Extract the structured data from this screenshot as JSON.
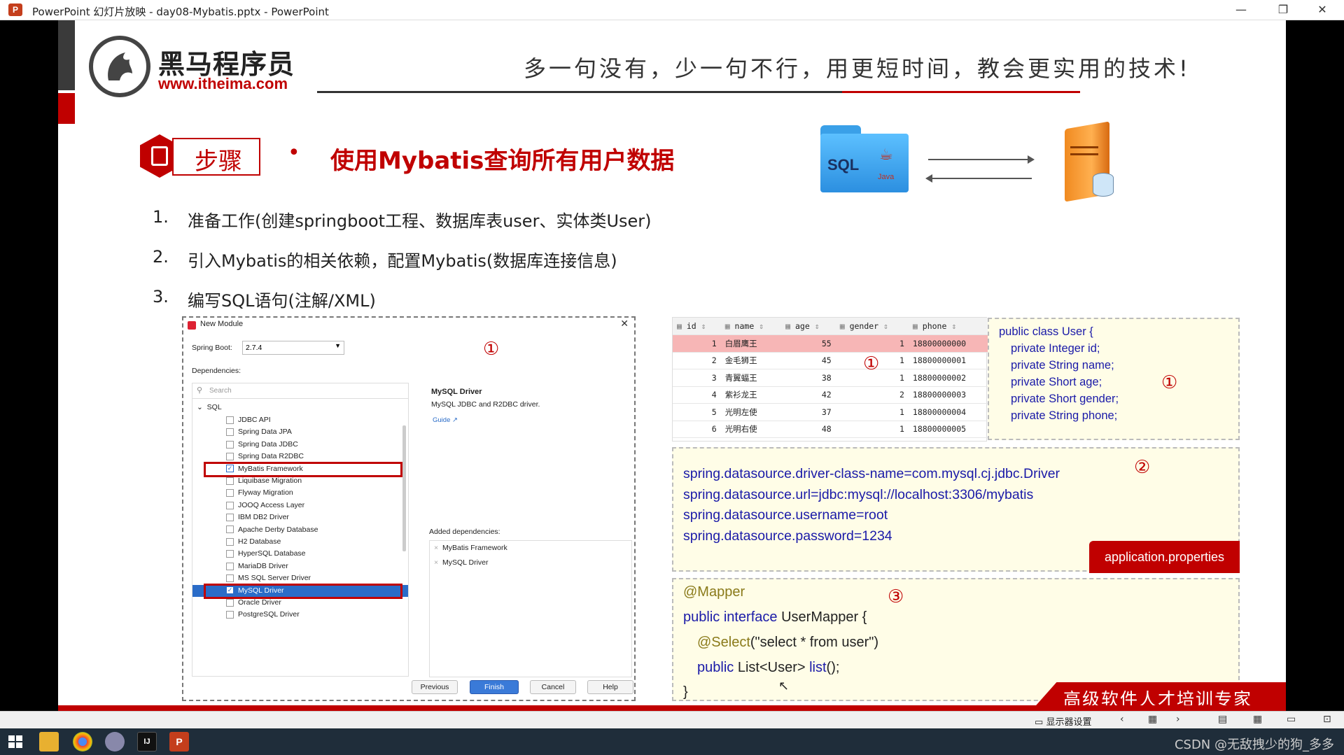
{
  "window": {
    "title": "PowerPoint 幻灯片放映  -  day08-Mybatis.pptx - PowerPoint",
    "app_icon": "P",
    "controls": {
      "minimize": "—",
      "restore": "❐",
      "close": "✕"
    }
  },
  "slide": {
    "logo": {
      "name": "黑马程序员",
      "url": "www.itheima.com"
    },
    "slogan": "多一句没有，少一句不行，用更短时间，教会更实用的技术!",
    "step_label": "步骤",
    "bullet": "•",
    "heading": "使用Mybatis查询所有用户数据",
    "diagram": {
      "sql_label": "SQL",
      "java_label": "Java"
    },
    "steps": [
      {
        "num": "1.",
        "text": "准备工作(创建springboot工程、数据库表user、实体类User)"
      },
      {
        "num": "2.",
        "text": "引入Mybatis的相关依赖，配置Mybatis(数据库连接信息)"
      },
      {
        "num": "3.",
        "text": "编写SQL语句(注解/XML)"
      }
    ],
    "dialog": {
      "title": "New Module",
      "close": "✕",
      "spring_boot_label": "Spring Boot:",
      "spring_boot_value": "2.7.4",
      "dependencies_label": "Dependencies:",
      "search_placeholder": "Search",
      "group": "SQL",
      "deps": [
        {
          "label": "JDBC API",
          "checked": false
        },
        {
          "label": "Spring Data JPA",
          "checked": false
        },
        {
          "label": "Spring Data JDBC",
          "checked": false
        },
        {
          "label": "Spring Data R2DBC",
          "checked": false
        },
        {
          "label": "MyBatis Framework",
          "checked": true
        },
        {
          "label": "Liquibase Migration",
          "checked": false
        },
        {
          "label": "Flyway Migration",
          "checked": false
        },
        {
          "label": "JOOQ Access Layer",
          "checked": false
        },
        {
          "label": "IBM DB2 Driver",
          "checked": false
        },
        {
          "label": "Apache Derby Database",
          "checked": false
        },
        {
          "label": "H2 Database",
          "checked": false
        },
        {
          "label": "HyperSQL Database",
          "checked": false
        },
        {
          "label": "MariaDB Driver",
          "checked": false
        },
        {
          "label": "MS SQL Server Driver",
          "checked": false
        },
        {
          "label": "MySQL Driver",
          "checked": true
        },
        {
          "label": "Oracle Driver",
          "checked": false
        },
        {
          "label": "PostgreSQL Driver",
          "checked": false
        }
      ],
      "detail_title": "MySQL Driver",
      "detail_desc": "MySQL JDBC and R2DBC driver.",
      "detail_link": "Guide ↗",
      "added_label": "Added dependencies:",
      "added": [
        "MyBatis Framework",
        "MySQL Driver"
      ],
      "buttons": {
        "previous": "Previous",
        "finish": "Finish",
        "cancel": "Cancel",
        "help": "Help"
      },
      "marker": "①"
    },
    "table": {
      "columns": [
        "id",
        "name",
        "age",
        "gender",
        "phone"
      ],
      "rows": [
        [
          "1",
          "白眉鹰王",
          "55",
          "1",
          "18800000000"
        ],
        [
          "2",
          "金毛狮王",
          "45",
          "1",
          "18800000001"
        ],
        [
          "3",
          "青翼蝠王",
          "38",
          "1",
          "18800000002"
        ],
        [
          "4",
          "紫衫龙王",
          "42",
          "2",
          "18800000003"
        ],
        [
          "5",
          "光明左使",
          "37",
          "1",
          "18800000004"
        ],
        [
          "6",
          "光明右使",
          "48",
          "1",
          "18800000005"
        ]
      ],
      "marker": "①"
    },
    "entity": {
      "lines": [
        "public class User {",
        "private Integer id;",
        "private String name;",
        "private Short age;",
        "private Short gender;",
        "private String phone;"
      ],
      "marker": "①"
    },
    "properties": {
      "lines": [
        "spring.datasource.driver-class-name=com.mysql.cj.jdbc.Driver",
        "spring.datasource.url=jdbc:mysql://localhost:3306/mybatis",
        "spring.datasource.username=root",
        "spring.datasource.password=1234"
      ],
      "badge": "application.properties",
      "marker": "②"
    },
    "mapper": {
      "annotation": "@Mapper",
      "line2_kw": "public interface",
      "line2_rest": " UserMapper {",
      "select_ann": "@Select",
      "select_str": "(\"select * from user\")",
      "line4_kw": "public",
      "line4_type": " List<User> ",
      "line4_method": "list",
      "line4_end": "();",
      "close": "}",
      "marker": "③"
    },
    "footer_banner": "高级软件人才培训专家"
  },
  "status_bar": {
    "display_settings": "显示器设置",
    "watermark": "CSDN @无敌拽少的狗_多多"
  },
  "colors": {
    "brand_red": "#c00000",
    "accent_blue": "#1f4e9c",
    "note_bg": "#fffde7"
  }
}
